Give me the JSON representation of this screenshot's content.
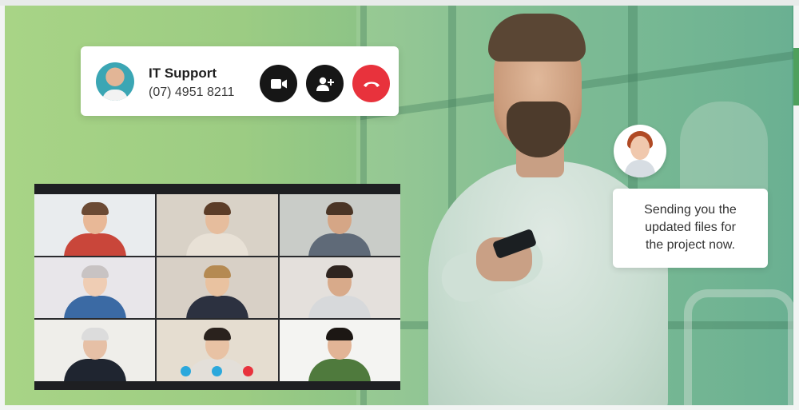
{
  "call": {
    "name": "IT Support",
    "number": "(07) 4951 8211",
    "actions": [
      {
        "icon": "video-camera-icon"
      },
      {
        "icon": "add-user-icon"
      },
      {
        "icon": "hang-up-icon"
      }
    ]
  },
  "message": {
    "lines": [
      "Sending you the",
      "updated files for",
      "the project now."
    ]
  },
  "video_grid": {
    "tiles": [
      {
        "bg": "#e9ecee",
        "skin": "#e8b897",
        "hair": "#6b4a34",
        "shirt": "#c9463a"
      },
      {
        "bg": "#d9d2c7",
        "skin": "#e6bd9d",
        "hair": "#5c3d28",
        "shirt": "#e8e1d6"
      },
      {
        "bg": "#c9ccc8",
        "skin": "#d5a686",
        "hair": "#4a3526",
        "shirt": "#5f6a78"
      },
      {
        "bg": "#e8e6ea",
        "skin": "#efcdb4",
        "hair": "#c8c3c3",
        "shirt": "#3b6aa4"
      },
      {
        "bg": "#d8d0c6",
        "skin": "#e9c2a0",
        "hair": "#b58a52",
        "shirt": "#2c3140"
      },
      {
        "bg": "#e4e0dc",
        "skin": "#d8aa8a",
        "hair": "#2f2520",
        "shirt": "#d7d9db"
      },
      {
        "bg": "#efeeea",
        "skin": "#e6c0a6",
        "hair": "#dcdcdc",
        "shirt": "#1f2530"
      },
      {
        "bg": "#e5ddd0",
        "skin": "#e8c2a4",
        "hair": "#2a221d",
        "shirt": "#e3dfd9"
      },
      {
        "bg": "#f4f4f2",
        "skin": "#e2b496",
        "hair": "#1c1714",
        "shirt": "#4f7a3d"
      }
    ],
    "controls": [
      {
        "icon": "microphone-icon",
        "color": "#2ba8dc"
      },
      {
        "icon": "video-camera-icon",
        "color": "#2ba8dc"
      },
      {
        "icon": "hang-up-icon",
        "color": "#e8323c"
      }
    ]
  }
}
